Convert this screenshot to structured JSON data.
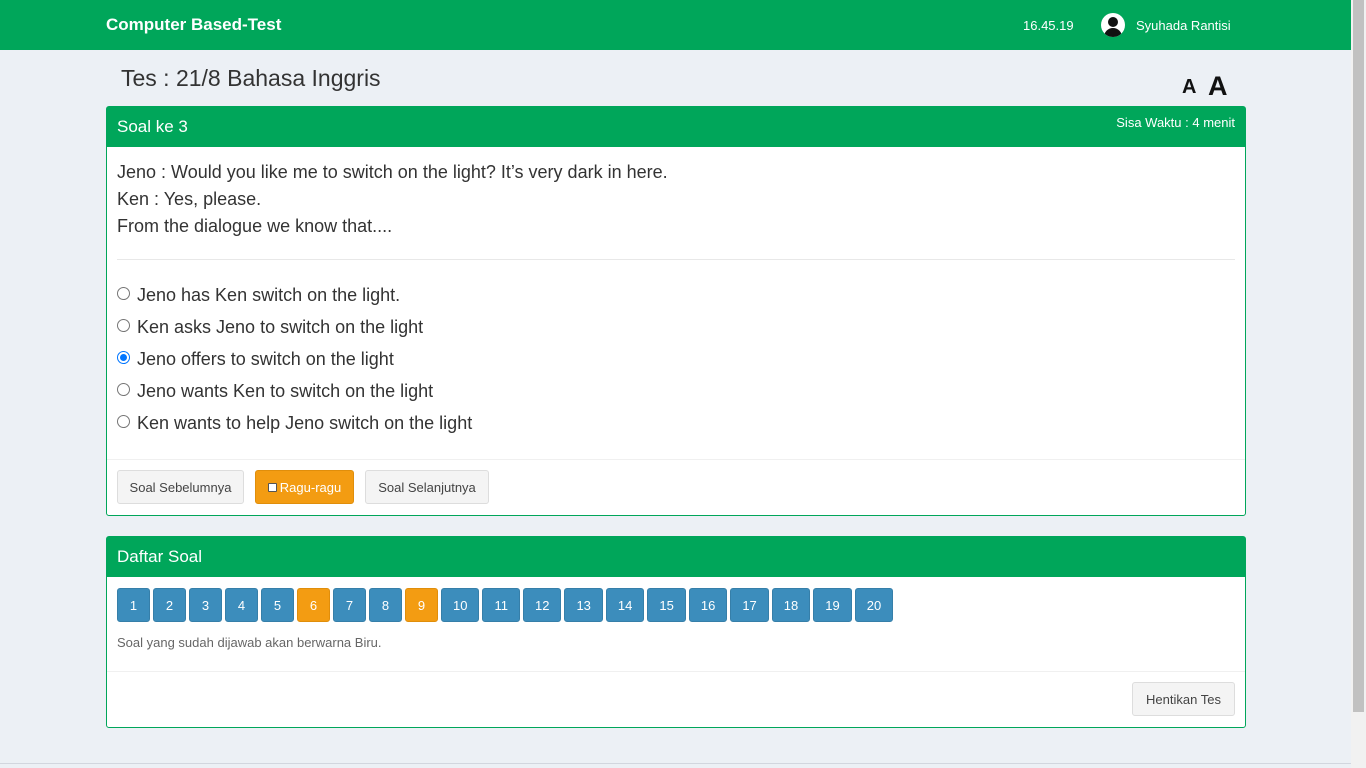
{
  "header": {
    "brand": "Computer Based-Test",
    "clock": "16.45.19",
    "user_name": "Syuhada Rantisi",
    "user_icon": "user-circle-icon"
  },
  "page": {
    "title": "Tes : 21/8 Bahasa Inggris",
    "font_small_label": "A",
    "font_large_label": "A"
  },
  "question": {
    "header_title": "Soal ke 3",
    "timer": "Sisa Waktu : 4 menit",
    "lines": [
      "Jeno : Would you like me to switch on the light? It’s very dark in here.",
      "Ken : Yes, please.",
      "From the dialogue we know that...."
    ],
    "options": [
      {
        "label": "Jeno has Ken switch on the light.",
        "selected": false
      },
      {
        "label": "Ken asks Jeno to switch on the light",
        "selected": false
      },
      {
        "label": "Jeno offers to switch on the light",
        "selected": true
      },
      {
        "label": "Jeno wants Ken to switch on the light",
        "selected": false
      },
      {
        "label": "Ken wants to help Jeno switch on the light",
        "selected": false
      }
    ],
    "buttons": {
      "prev": "Soal Sebelumnya",
      "doubt": "Ragu-ragu",
      "next": "Soal Selanjutnya"
    }
  },
  "list": {
    "header_title": "Daftar Soal",
    "numbers": [
      {
        "label": "1",
        "state": "answered"
      },
      {
        "label": "2",
        "state": "answered"
      },
      {
        "label": "3",
        "state": "answered"
      },
      {
        "label": "4",
        "state": "answered"
      },
      {
        "label": "5",
        "state": "answered"
      },
      {
        "label": "6",
        "state": "doubt"
      },
      {
        "label": "7",
        "state": "answered"
      },
      {
        "label": "8",
        "state": "answered"
      },
      {
        "label": "9",
        "state": "doubt"
      },
      {
        "label": "10",
        "state": "answered"
      },
      {
        "label": "11",
        "state": "answered"
      },
      {
        "label": "12",
        "state": "answered"
      },
      {
        "label": "13",
        "state": "answered"
      },
      {
        "label": "14",
        "state": "answered"
      },
      {
        "label": "15",
        "state": "answered"
      },
      {
        "label": "16",
        "state": "answered"
      },
      {
        "label": "17",
        "state": "answered"
      },
      {
        "label": "18",
        "state": "answered"
      },
      {
        "label": "19",
        "state": "answered"
      },
      {
        "label": "20",
        "state": "answered"
      }
    ],
    "note": "Soal yang sudah dijawab akan berwarna Biru.",
    "stop_label": "Hentikan Tes"
  },
  "colors": {
    "brand_green": "#00a65a",
    "answered_blue": "#3c8dbc",
    "doubt_orange": "#f39c12",
    "page_bg": "#ecf0f5"
  }
}
